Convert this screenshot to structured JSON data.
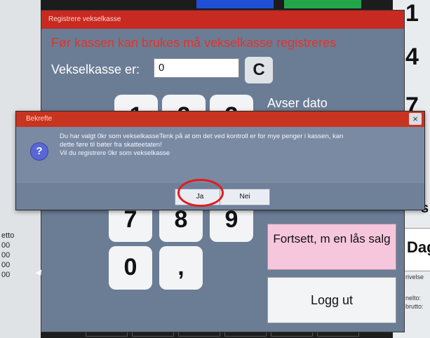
{
  "main_window": {
    "title": "Registrere vekselkasse",
    "warning": "Før kassen kan brukes må vekselkasse registreres",
    "vekselkasse_label": "Vekselkasse er:",
    "vekselkasse_value": "0",
    "clear_label": "C",
    "avser_dato_label": "Avser dato",
    "keypad": [
      "1",
      "2",
      "3",
      "7",
      "8",
      "9",
      "0",
      ","
    ],
    "fortsett_label": "Fortsett, m en lås salg",
    "logg_ut_label": "Logg ut"
  },
  "dialog": {
    "title": "Bekrefte",
    "close_label": "×",
    "icon_glyph": "?",
    "message_line1": "Du har valgt 0kr som vekselkasseTenk på at om det ved kontroll er for mye penger i kassen, kan",
    "message_line2": "dette føre til bøter fra skatteetaten!",
    "message_line3": "Vil du registrere 0kr som vekselkasse",
    "yes_label": "Ja",
    "no_label": "Nei"
  },
  "background": {
    "right_digits": [
      "1",
      "4",
      "7"
    ],
    "right_s": "s",
    "right_dag": "Dag",
    "right_small": [
      "rivelse",
      "nelto:",
      "brutto:"
    ],
    "left_small": [
      "etto",
      "00",
      "00",
      "00",
      "00"
    ]
  },
  "colors": {
    "title_red": "#c82920",
    "warning_red": "#e1332b",
    "window_body": "#6b7d95",
    "pink_button": "#f6c7dc",
    "highlight_circle": "#e41b1b"
  }
}
